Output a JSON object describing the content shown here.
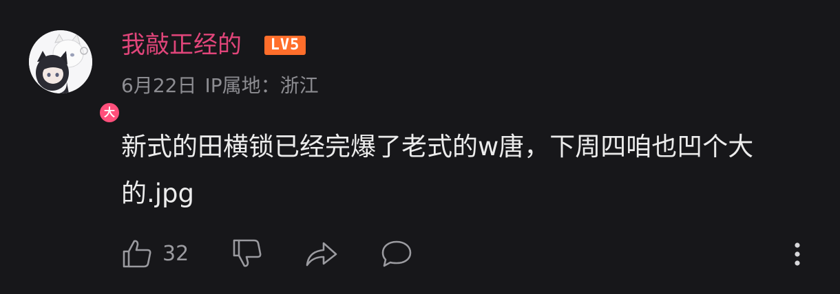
{
  "comment": {
    "author": {
      "name": "我敲正经的",
      "level": "LV5",
      "role_badge": "大",
      "name_color": "#e0457a",
      "level_color": "#ff6e2b",
      "role_badge_color": "#ff4f7b"
    },
    "date": "6月22日",
    "ip_location": "IP属地：浙江",
    "content": "新式的田横锁已经完爆了老式的w唐，下周四咱也凹个大的.jpg",
    "actions": {
      "like_icon": "thumbs-up-icon",
      "like_count": "32",
      "dislike_icon": "thumbs-down-icon",
      "share_icon": "share-icon",
      "reply_icon": "speech-bubble-icon",
      "more_icon": "more-vertical-icon"
    }
  }
}
